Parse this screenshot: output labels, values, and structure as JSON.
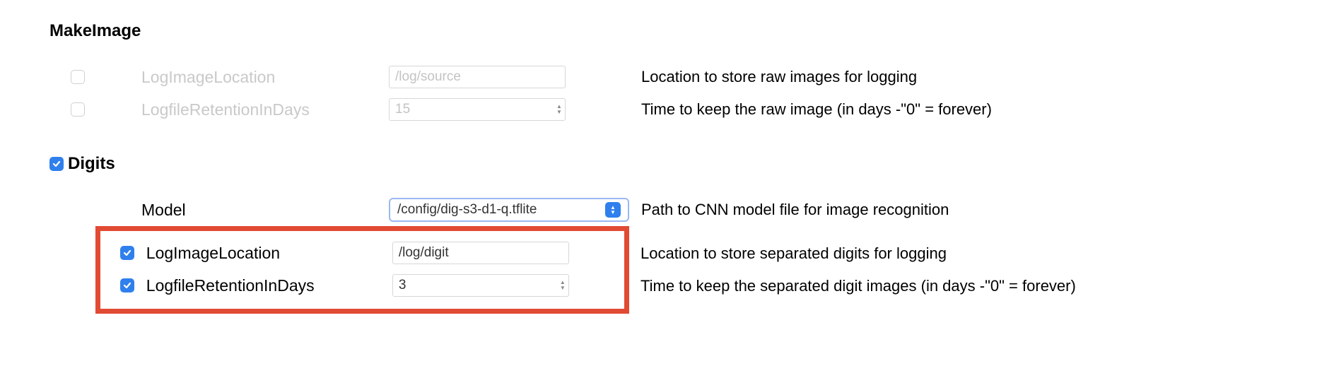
{
  "makeimage": {
    "title": "MakeImage",
    "rows": [
      {
        "key": "log_image_location",
        "checked": false,
        "label": "LogImageLocation",
        "input_type": "text",
        "value": "/log/source",
        "desc": "Location to store raw images for logging",
        "disabled": true
      },
      {
        "key": "logfile_retention",
        "checked": false,
        "label": "LogfileRetentionInDays",
        "input_type": "number",
        "value": "15",
        "desc": "Time to keep the raw image (in days -\"0\" = forever)",
        "disabled": true
      }
    ]
  },
  "digits": {
    "title": "Digits",
    "section_checked": true,
    "model_row": {
      "label": "Model",
      "value": "/config/dig-s3-d1-q.tflite",
      "desc": "Path to CNN model file for image recognition"
    },
    "hl_rows": [
      {
        "key": "log_image_location",
        "checked": true,
        "label": "LogImageLocation",
        "input_type": "text",
        "value": "/log/digit",
        "desc": "Location to store separated digits for logging"
      },
      {
        "key": "logfile_retention",
        "checked": true,
        "label": "LogfileRetentionInDays",
        "input_type": "number",
        "value": "3",
        "desc": "Time to keep the separated digit images (in days -\"0\" = forever)"
      }
    ]
  }
}
